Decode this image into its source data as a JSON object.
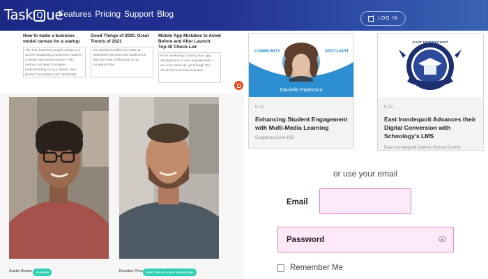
{
  "header": {
    "logo_left": "Task",
    "logo_q": "Q",
    "logo_right": "ue",
    "nav": [
      "Features",
      "Pricing",
      "Support",
      "Blog"
    ],
    "login_label": "LOG IN"
  },
  "blog": [
    {
      "title": "How to make a business model canvas for a startup",
      "excerpt": "The lean business model canvas is a tool for visualizing a business model in a simple structured manner. This method can lead to a better understanding of your clients, how product innovations are distributed through which channels, and what brings the most profit."
    },
    {
      "title": "Good Things of 2020. Great Trends of 2021",
      "excerpt": "We wanted to reflect on 2020 as TaskWebs has been the hardest but also the most fruitful year in our company's life."
    },
    {
      "title": "Mobile App Mistakes to Avoid Before and After Launch. Top-30 Check-List",
      "excerpt": "From marketing to hiring from app development to user engagement — we cover them all, go through this check-list to ensure success!"
    }
  ],
  "team": [
    {
      "name": "Austin Betzer",
      "role": "FOUNDER"
    },
    {
      "name": "Bowdrie Price",
      "role": "DIRECTOR OF CLIENT OPERATIONS"
    }
  ],
  "cards": [
    {
      "banner_left": "COMMUNITY",
      "banner_right": "SPOTLIGHT",
      "banner_name": "Danielle Patterson",
      "tag": "K-12",
      "title": "Enhancing Student Engagement with Multi-Media Learning",
      "subtitle": "Copperas Cove ISD"
    },
    {
      "seal_text": "EAST IRONDEQUOIT",
      "tag": "K-12",
      "title": "East Irondequoit Advances their Digital Conversion with Schoology's LMS",
      "subtitle": "East Irondequoit Central School District"
    }
  ],
  "form": {
    "divider_text": "or use your email",
    "email_label": "Email",
    "email_value": "",
    "password_label": "Password",
    "password_value": "",
    "remember_label": "Remember Me",
    "remember_checked": false
  },
  "icons": {
    "login": "login-icon",
    "eye": "eye-icon",
    "fab": "clipboard-icon"
  },
  "colors": {
    "header": "#233191",
    "accent_red": "#e8471c",
    "badge": "#2dd0b0",
    "input_bg": "#fce8f7",
    "input_border": "#d98ec8",
    "spotlight_blue": "#2d8fd2"
  }
}
